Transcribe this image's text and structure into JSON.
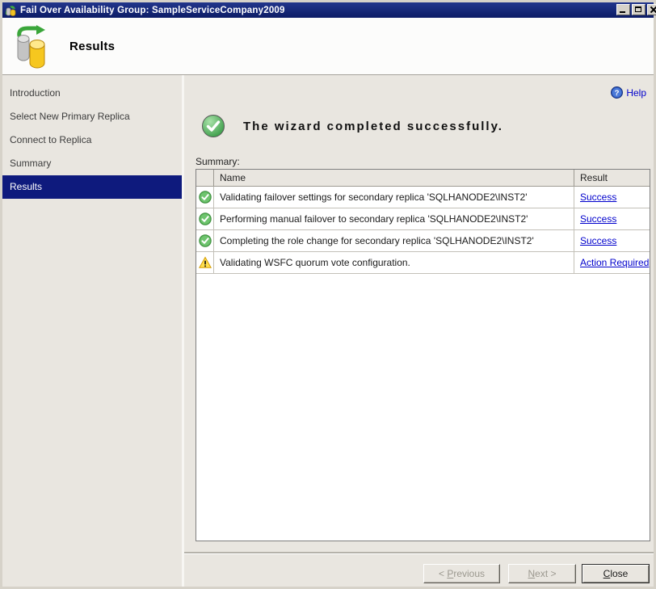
{
  "window": {
    "title": "Fail Over Availability Group: SampleServiceCompany2009"
  },
  "header": {
    "title": "Results"
  },
  "sidebar": {
    "items": [
      {
        "label": "Introduction",
        "selected": false
      },
      {
        "label": "Select New Primary Replica",
        "selected": false
      },
      {
        "label": "Connect to Replica",
        "selected": false
      },
      {
        "label": "Summary",
        "selected": false
      },
      {
        "label": "Results",
        "selected": true
      }
    ]
  },
  "main": {
    "help_label": "Help",
    "status_message": "The wizard completed successfully.",
    "summary_label": "Summary:",
    "table": {
      "columns": {
        "icon": "",
        "name": "Name",
        "result": "Result"
      },
      "rows": [
        {
          "icon": "success-icon",
          "name": "Validating failover settings for secondary replica 'SQLHANODE2\\INST2'",
          "result": "Success"
        },
        {
          "icon": "success-icon",
          "name": "Performing manual failover to secondary replica 'SQLHANODE2\\INST2'",
          "result": "Success"
        },
        {
          "icon": "success-icon",
          "name": "Completing the role change for secondary replica 'SQLHANODE2\\INST2'",
          "result": "Success"
        },
        {
          "icon": "warning-icon",
          "name": "Validating WSFC quorum vote configuration.",
          "result": "Action Required"
        }
      ]
    },
    "buttons": {
      "previous": {
        "pre": "< ",
        "mnemonic": "P",
        "post": "revious",
        "enabled": false
      },
      "next": {
        "pre": "",
        "mnemonic": "N",
        "post": "ext >",
        "enabled": false
      },
      "close": {
        "pre": "",
        "mnemonic": "C",
        "post": "lose",
        "enabled": true
      }
    }
  },
  "icons": {
    "help_glyph": "?"
  },
  "colors": {
    "titlebar_navy": "#0e1d66",
    "selected_item_navy": "#0e1a7d",
    "link_blue": "#0000cc",
    "success_green": "#4caf50",
    "warning_yellow": "#ffdf4d",
    "header_band": "#fcfcfb",
    "chrome_gray": "#e9e6e0"
  }
}
